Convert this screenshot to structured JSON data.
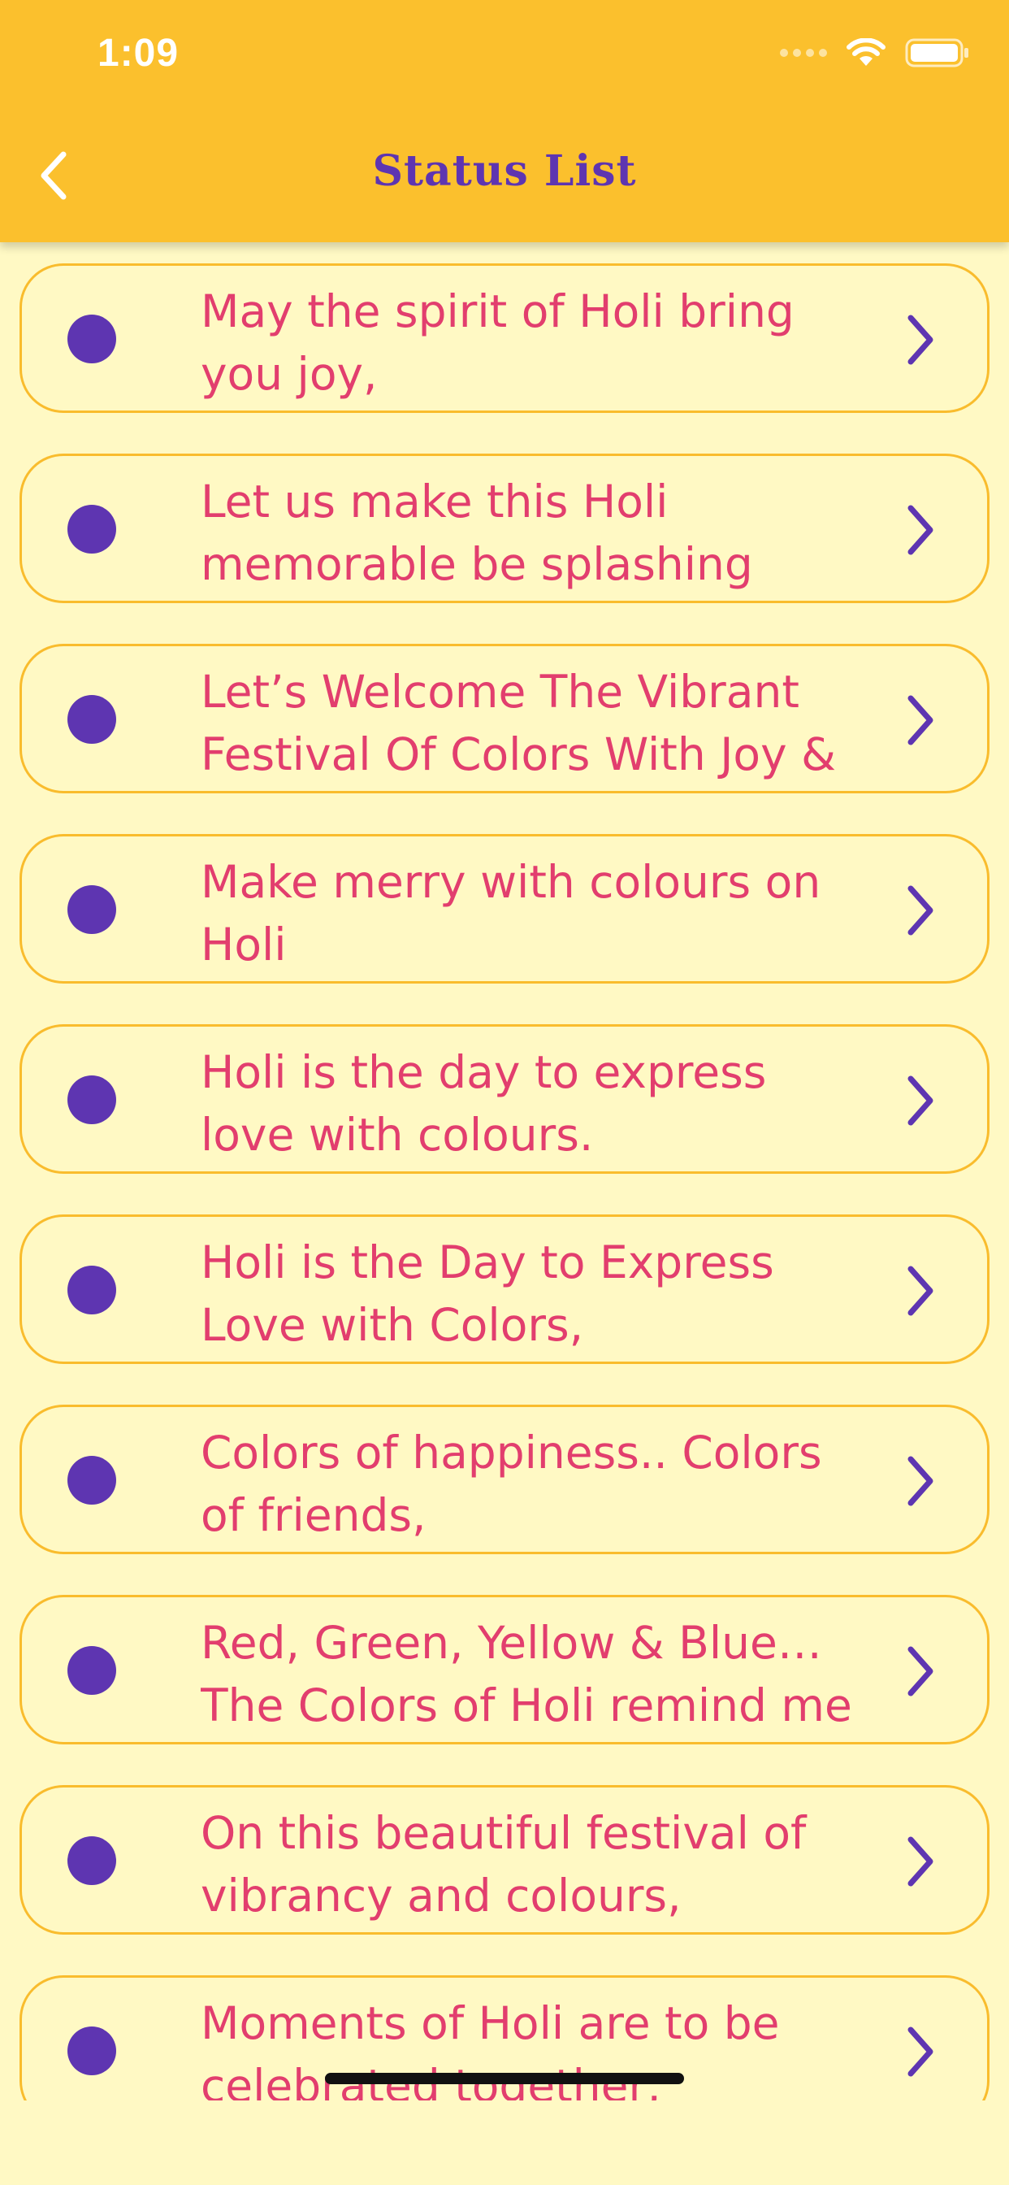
{
  "status_bar": {
    "time": "1:09"
  },
  "header": {
    "title": "Status List",
    "back_icon": "chevron-left-icon"
  },
  "colors": {
    "header_bg": "#FBC02D",
    "page_bg": "#FFF9C4",
    "accent": "#5E35B1",
    "text": "#E23E6E",
    "card_border": "#F9BC2D"
  },
  "items": [
    {
      "text": "May the spirit of Holi bring\nyou joy,"
    },
    {
      "text": "Let us make this Holi\nmemorable be splashing"
    },
    {
      "text": "Let’s Welcome The Vibrant\nFestival Of Colors With Joy &"
    },
    {
      "text": "Make merry with colours on\nHoli"
    },
    {
      "text": "Holi is the day to express\nlove with colours."
    },
    {
      "text": "Holi is the Day to Express\nLove with Colors,"
    },
    {
      "text": "Colors of happiness.. Colors\nof friends,"
    },
    {
      "text": "Red, Green, Yellow & Blue…\nThe Colors of Holi remind me"
    },
    {
      "text": "On this beautiful festival of\nvibrancy and colours,"
    },
    {
      "text": "Moments of Holi are to be\ncelebrated together,"
    }
  ]
}
